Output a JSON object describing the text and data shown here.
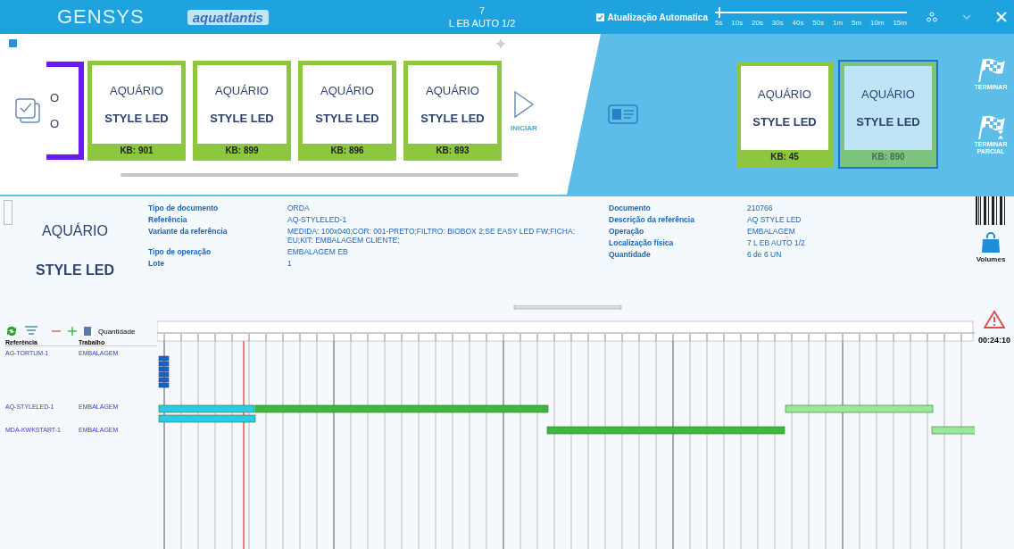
{
  "header": {
    "logo": "GENSYS",
    "brand": "aquatlantis",
    "station_number": "7",
    "station_name": "L EB AUTO 1/2",
    "auto_update": {
      "label": "Atualização Automatica",
      "checked": true
    },
    "refresh_slider": {
      "level": 0.02,
      "ticks": [
        "5s",
        "10s",
        "20s",
        "30s",
        "40s",
        "50s",
        "1m",
        "5m",
        "10m",
        "15m"
      ]
    }
  },
  "queue": {
    "cards": [
      {
        "kind": "partial",
        "line1": "O",
        "line2": "O",
        "color": "#6a1bf0"
      },
      {
        "kind": "card",
        "line1": "AQUÁRIO",
        "line2": "STYLE LED",
        "kb": "KB: 901",
        "color": "#8dc63f",
        "selected": false
      },
      {
        "kind": "card",
        "line1": "AQUÁRIO",
        "line2": "STYLE LED",
        "kb": "KB: 899",
        "color": "#8dc63f",
        "selected": false
      },
      {
        "kind": "card",
        "line1": "AQUÁRIO",
        "line2": "STYLE LED",
        "kb": "KB: 896",
        "color": "#8dc63f",
        "selected": false
      },
      {
        "kind": "card",
        "line1": "AQUÁRIO",
        "line2": "STYLE LED",
        "kb": "KB: 893",
        "color": "#8dc63f",
        "selected": false
      }
    ],
    "start_button": "INICIAR"
  },
  "active": {
    "cards": [
      {
        "line1": "AQUÁRIO",
        "line2": "STYLE LED",
        "kb": "KB: 45",
        "selected": false
      },
      {
        "line1": "AQUÁRIO",
        "line2": "STYLE LED",
        "kb": "KB: 890",
        "selected": true
      }
    ]
  },
  "side_actions": [
    "TERMINAR",
    "TERMINAR PARCIAL"
  ],
  "details": {
    "product_line1": "AQUÁRIO",
    "product_line2": "STYLE LED",
    "left": [
      {
        "label": "Tipo de documento",
        "value": "ORDA"
      },
      {
        "label": "Referência",
        "value": "AQ-STYLELED-1"
      },
      {
        "label": "Variante da referência",
        "value": "MEDIDA: 100x040;COR: 001-PRETO;FILTRO: BIOBOX 2;SE EASY LED FW;FICHA: EU;KIT: EMBALAGEM CLIENTE;"
      },
      {
        "label": "Tipo de operação",
        "value": "EMBALAGEM EB"
      },
      {
        "label": "Lote",
        "value": "1"
      }
    ],
    "right": [
      {
        "label": "Documento",
        "value": "210766"
      },
      {
        "label": "Descrição da referência",
        "value": "AQ STYLE LED"
      },
      {
        "label": "Operação",
        "value": "EMBALAGEM"
      },
      {
        "label": "Localização física",
        "value": "7 L EB AUTO 1/2"
      },
      {
        "label": "Quantidade",
        "value": "6 de 6 UN"
      }
    ]
  },
  "volumes_label": "Volumes",
  "gantt": {
    "quantity_label": "Quantidade",
    "columns": [
      "Referência",
      "Trabalho"
    ],
    "rows": [
      {
        "reference": "AG-TORTUM-1",
        "work": "EMBALAGEM"
      },
      {
        "reference": "AQ-STYLELED-1",
        "work": "EMBALAGEM"
      },
      {
        "reference": "MDA-KWKSTART-1",
        "work": "EMBALAGEM"
      }
    ]
  },
  "timer": "00:24:10"
}
